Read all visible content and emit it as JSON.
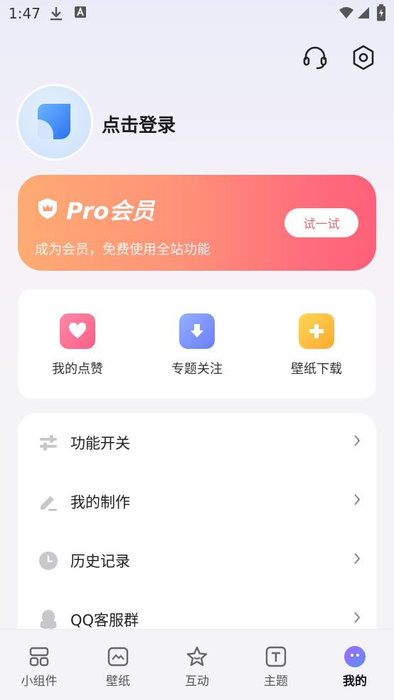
{
  "status_bar": {
    "time": "1:47"
  },
  "profile": {
    "login_text": "点击登录"
  },
  "pro_card": {
    "title": "Pro会员",
    "subtitle": "成为会员，免费使用全站功能",
    "button": "试一试"
  },
  "quick_actions": [
    {
      "label": "我的点赞",
      "icon": "heart-icon",
      "color": "#ff6f92"
    },
    {
      "label": "专题关注",
      "icon": "download-arrow-icon",
      "color": "#7f94ff"
    },
    {
      "label": "壁纸下载",
      "icon": "plus-icon",
      "color": "#ffc043"
    }
  ],
  "menu": [
    {
      "label": "功能开关",
      "icon": "sliders-icon"
    },
    {
      "label": "我的制作",
      "icon": "pencil-icon"
    },
    {
      "label": "历史记录",
      "icon": "clock-icon"
    },
    {
      "label": "QQ客服群",
      "icon": "penguin-icon"
    }
  ],
  "tabs": [
    {
      "label": "小组件",
      "icon": "widget-grid-icon",
      "active": false
    },
    {
      "label": "壁纸",
      "icon": "wallpaper-icon",
      "active": false
    },
    {
      "label": "互动",
      "icon": "star-icon",
      "active": false
    },
    {
      "label": "主题",
      "icon": "theme-t-icon",
      "active": false
    },
    {
      "label": "我的",
      "icon": "me-face-icon",
      "active": true
    }
  ],
  "colors": {
    "accent_start": "#ffab74",
    "accent_end": "#ff5f7a",
    "try_text": "#f26b6b",
    "background": "#f4f4f6"
  }
}
